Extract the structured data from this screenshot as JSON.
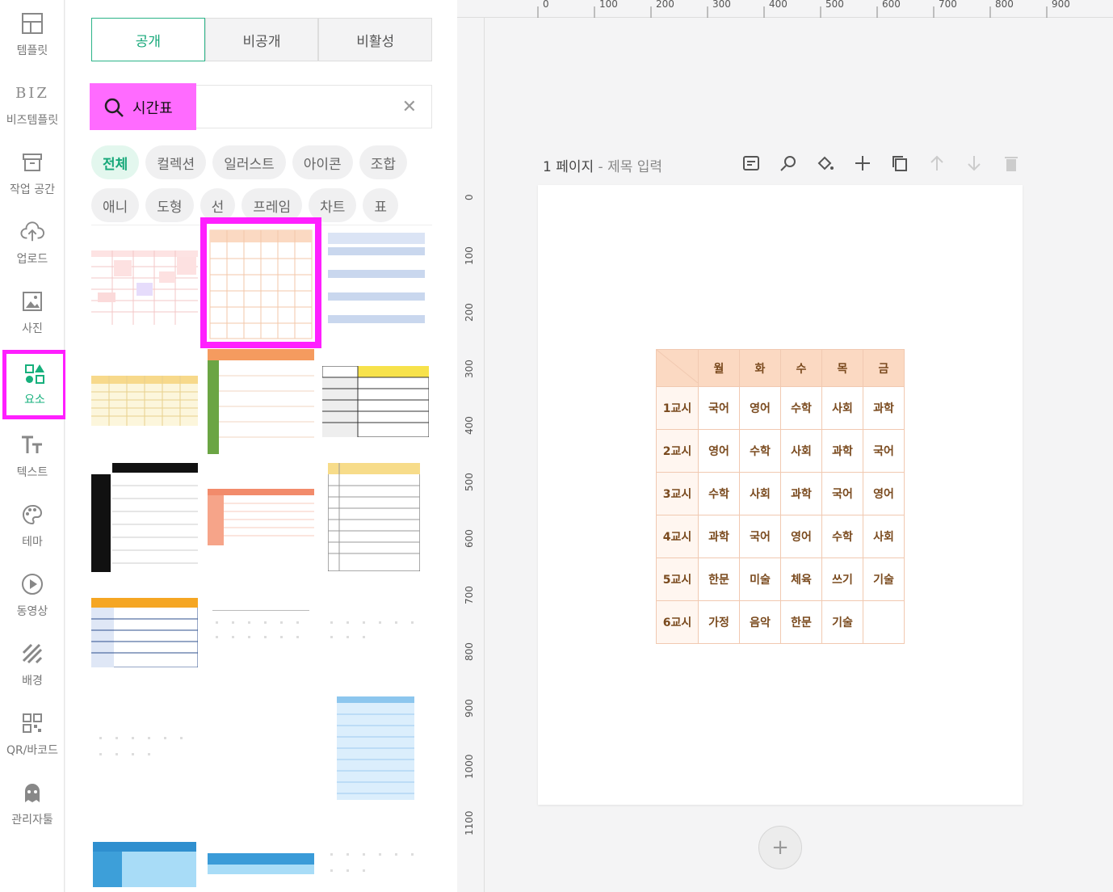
{
  "sidebar": {
    "items": [
      {
        "label": "템플릿",
        "icon": "template-icon"
      },
      {
        "label": "비즈템플릿",
        "icon": "biz-icon",
        "glyph": "BIZ"
      },
      {
        "label": "작업 공간",
        "icon": "workspace-icon"
      },
      {
        "label": "업로드",
        "icon": "upload-icon"
      },
      {
        "label": "사진",
        "icon": "photo-icon"
      },
      {
        "label": "요소",
        "icon": "elements-icon",
        "active": true
      },
      {
        "label": "텍스트",
        "icon": "text-icon"
      },
      {
        "label": "테마",
        "icon": "palette-icon"
      },
      {
        "label": "동영상",
        "icon": "video-icon"
      },
      {
        "label": "배경",
        "icon": "background-icon"
      },
      {
        "label": "QR/바코드",
        "icon": "qr-icon"
      },
      {
        "label": "관리자툴",
        "icon": "admin-icon"
      }
    ]
  },
  "panel": {
    "tabs": [
      "공개",
      "비공개",
      "비활성"
    ],
    "search": {
      "value": "시간표"
    },
    "chips_row1": [
      "전체",
      "컬렉션",
      "일러스트",
      "아이콘",
      "조합"
    ],
    "chips_row2": [
      "애니",
      "도형",
      "선",
      "프레임",
      "차트",
      "표"
    ]
  },
  "canvas": {
    "ruler_top": [
      "0",
      "100",
      "200",
      "300",
      "400",
      "500",
      "600",
      "700",
      "800",
      "900"
    ],
    "ruler_left": [
      "0",
      "100",
      "200",
      "300",
      "400",
      "500",
      "600",
      "700",
      "800",
      "900",
      "1000",
      "1100"
    ],
    "page_number": "1 페이지",
    "title_placeholder": "- 제목 입력",
    "add_page": "+"
  },
  "timetable": {
    "days": [
      "월",
      "화",
      "수",
      "목",
      "금"
    ],
    "rows": [
      {
        "period": "1교시",
        "subjects": [
          "국어",
          "영어",
          "수학",
          "사회",
          "과학"
        ]
      },
      {
        "period": "2교시",
        "subjects": [
          "영어",
          "수학",
          "사회",
          "과학",
          "국어"
        ]
      },
      {
        "period": "3교시",
        "subjects": [
          "수학",
          "사회",
          "과학",
          "국어",
          "영어"
        ]
      },
      {
        "period": "4교시",
        "subjects": [
          "과학",
          "국어",
          "영어",
          "수학",
          "사회"
        ]
      },
      {
        "period": "5교시",
        "subjects": [
          "한문",
          "미술",
          "체육",
          "쓰기",
          "기술"
        ]
      },
      {
        "period": "6교시",
        "subjects": [
          "가정",
          "음악",
          "한문",
          "기술",
          ""
        ]
      }
    ]
  }
}
